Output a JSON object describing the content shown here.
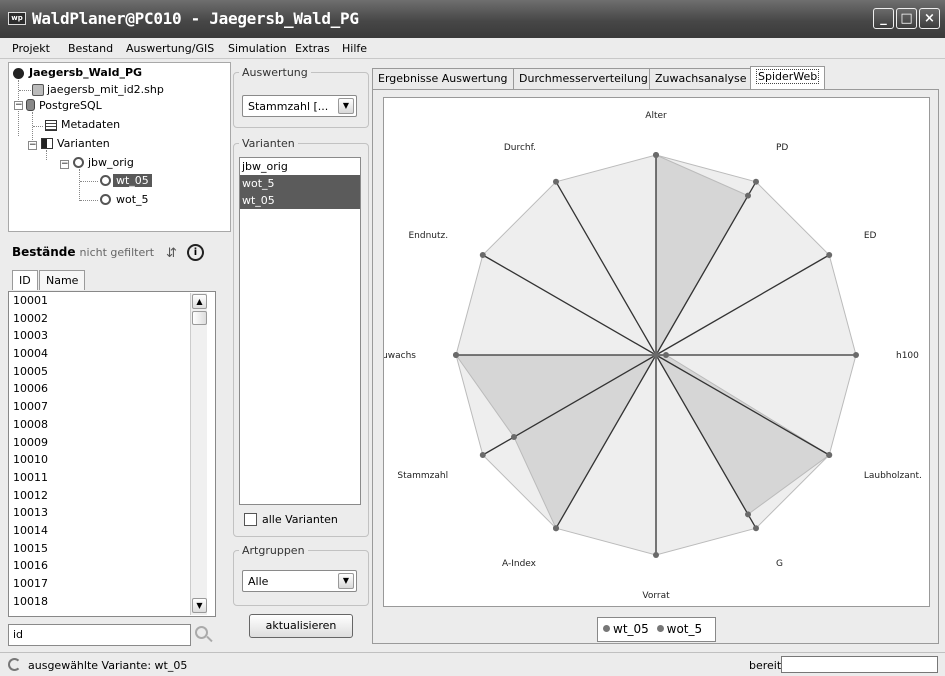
{
  "window": {
    "app_icon_text": "wp",
    "title": "WaldPlaner@PC010 - Jaegersb_Wald_PG"
  },
  "menu": [
    "Projekt",
    "Bestand",
    "Auswertung/GIS",
    "Simulation",
    "Extras",
    "Hilfe"
  ],
  "tree": {
    "root": "Jaegersb_Wald_PG",
    "shp": "jaegersb_mit_id2.shp",
    "db": "PostgreSQL",
    "metadaten": "Metadaten",
    "varianten": "Varianten",
    "variant_orig": "jbw_orig",
    "variant_wt05": "wt_05",
    "variant_wot5": "wot_5"
  },
  "bestaende": {
    "title": "Bestände",
    "filter_status": "nicht gefiltert",
    "tab_id": "ID",
    "tab_name": "Name",
    "ids": [
      "10001",
      "10002",
      "10003",
      "10004",
      "10005",
      "10006",
      "10007",
      "10008",
      "10009",
      "10010",
      "10011",
      "10012",
      "10013",
      "10014",
      "10015",
      "10016",
      "10017",
      "10018"
    ],
    "search_value": "id"
  },
  "auswertung": {
    "label": "Auswertung",
    "selected": "Stammzahl [..."
  },
  "varianten": {
    "label": "Varianten",
    "items": [
      {
        "name": "jbw_orig",
        "selected": false
      },
      {
        "name": "wot_5",
        "selected": true
      },
      {
        "name": "wt_05",
        "selected": true
      }
    ],
    "all_label": "alle Varianten"
  },
  "artgruppen": {
    "label": "Artgruppen",
    "selected": "Alle"
  },
  "update_button": "aktualisieren",
  "tabs": [
    {
      "label": "Ergebnisse Auswertung",
      "active": false
    },
    {
      "label": "Durchmesserverteilung",
      "active": false
    },
    {
      "label": "Zuwachsanalyse",
      "active": false
    },
    {
      "label": "SpiderWeb",
      "active": true
    }
  ],
  "chart_data": {
    "type": "radar",
    "axes": [
      "Alter",
      "PD",
      "ED",
      "h100",
      "Laubholzant.",
      "G",
      "Vorrat",
      "A-Index",
      "Stammzahl",
      "Zuwachs",
      "Endnutz.",
      "Durchf."
    ],
    "series": [
      {
        "name": "wt_05",
        "values": [
          1.0,
          0.92,
          0.0,
          0.05,
          1.0,
          0.92,
          0.0,
          1.0,
          0.82,
          1.0,
          0.0,
          0.0
        ]
      },
      {
        "name": "wot_5",
        "values": [
          1.0,
          1.0,
          1.0,
          1.0,
          1.0,
          1.0,
          1.0,
          1.0,
          1.0,
          1.0,
          1.0,
          1.0
        ]
      }
    ],
    "colors": {
      "wt_05": "#d6d6d6",
      "wot_5": "#eeeeee",
      "spoke": "#333333",
      "marker": "#6a6a6a"
    }
  },
  "status": {
    "text": "ausgewählte Variante: wt_05",
    "state": "bereit"
  }
}
